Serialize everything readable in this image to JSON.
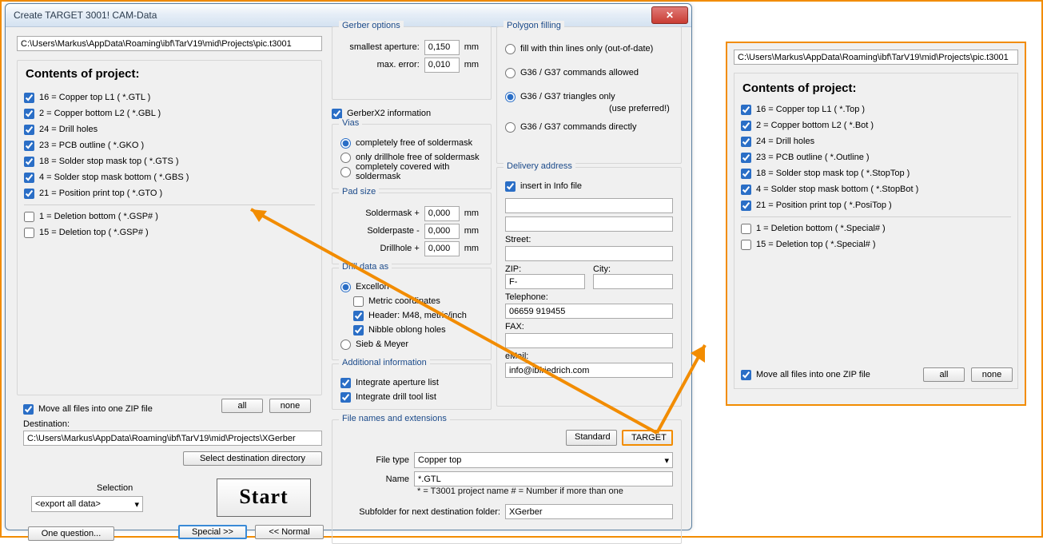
{
  "window": {
    "title": "Create TARGET 3001! CAM-Data"
  },
  "path": "C:\\Users\\Markus\\AppData\\Roaming\\ibf\\TarV19\\mid\\Projects\\pic.t3001",
  "contents_title": "Contents of project:",
  "layers_main": [
    {
      "c": true,
      "t": "16 = Copper top L1   ( *.GTL )"
    },
    {
      "c": true,
      "t": "2 = Copper bottom L2   ( *.GBL )"
    },
    {
      "c": true,
      "t": "24 = Drill holes"
    },
    {
      "c": true,
      "t": "23 = PCB outline   ( *.GKO )"
    },
    {
      "c": true,
      "t": "18 = Solder stop mask top   ( *.GTS )"
    },
    {
      "c": true,
      "t": "4 = Solder stop mask bottom   ( *.GBS )"
    },
    {
      "c": true,
      "t": "21 = Position print top   ( *.GTO )"
    }
  ],
  "layers_main_extra": [
    {
      "c": false,
      "t": "1 = Deletion bottom   ( *.GSP# )"
    },
    {
      "c": false,
      "t": "15 = Deletion top   ( *.GSP# )"
    }
  ],
  "zip_label": "Move all files into one ZIP file",
  "btn_all": "all",
  "btn_none": "none",
  "dest_label": "Destination:",
  "dest_path": "C:\\Users\\Markus\\AppData\\Roaming\\ibf\\TarV19\\mid\\Projects\\XGerber",
  "btn_seldest": "Select destination directory",
  "selection_label": "Selection",
  "selection_value": "<export all data>",
  "btn_start": "Start",
  "btn_oneq": "One question...",
  "btn_special": "Special >>",
  "btn_normal": "<<  Normal",
  "gerber": {
    "legend": "Gerber options",
    "ap_label": "smallest aperture:",
    "ap_value": "0,150",
    "err_label": "max. error:",
    "err_value": "0,010",
    "unit": "mm",
    "x2_label": "GerberX2 information"
  },
  "vias": {
    "legend": "Vias",
    "o1": "completely free of soldermask",
    "o2": "only drillhole free of soldermask",
    "o3": "completely covered with soldermask"
  },
  "pad": {
    "legend": "Pad size",
    "r1": "Soldermask  +",
    "r2": "Solderpaste  -",
    "r3": "Drillhole  +",
    "v": "0,000",
    "unit": "mm"
  },
  "drill": {
    "legend": "Drill data as",
    "excellon": "Excellon",
    "metric": "Metric coordinates",
    "header": "Header: M48, metric/inch",
    "nibble": "Nibble oblong holes",
    "sieb": "Sieb & Meyer"
  },
  "addl": {
    "legend": "Additional information",
    "a1": "Integrate aperture list",
    "a2": "Integrate drill tool list"
  },
  "poly": {
    "legend": "Polygon filling",
    "o1": "fill with thin lines only (out-of-date)",
    "o2": "G36 / G37 commands allowed",
    "o3": "G36 / G37 triangles only",
    "o3b": "(use preferred!)",
    "o4": "G36 / G37 commands directly"
  },
  "deliv": {
    "legend": "Delivery address",
    "insert": "insert in Info file",
    "street": "Street:",
    "zip": "ZIP:",
    "city": "City:",
    "zip_v": "F-",
    "tel": "Telephone:",
    "tel_v": "06659 919455",
    "fax": "FAX:",
    "email": "eMail:",
    "email_v": "info@ibfriedrich.com"
  },
  "fn": {
    "legend": "File names and extensions",
    "standard": "Standard",
    "target": "TARGET",
    "filetype_l": "File type",
    "filetype_v": "Copper top",
    "name_l": "Name",
    "name_v": "*.GTL",
    "hint": "* = T3001 project name            # = Number if more than one",
    "sub_l": "Subfolder for next destination folder:",
    "sub_v": "XGerber"
  },
  "panelR": {
    "path": "C:\\Users\\Markus\\AppData\\Roaming\\ibf\\TarV19\\mid\\Projects\\pic.t3001",
    "title": "Contents of project:",
    "layers": [
      {
        "c": true,
        "t": "16 = Copper top L1   ( *.Top )"
      },
      {
        "c": true,
        "t": "2 = Copper bottom L2   ( *.Bot )"
      },
      {
        "c": true,
        "t": "24 = Drill holes"
      },
      {
        "c": true,
        "t": "23 = PCB outline   ( *.Outline )"
      },
      {
        "c": true,
        "t": "18 = Solder stop mask top   ( *.StopTop )"
      },
      {
        "c": true,
        "t": "4 = Solder stop mask bottom   ( *.StopBot )"
      },
      {
        "c": true,
        "t": "21 = Position print top   ( *.PosiTop )"
      }
    ],
    "layers_extra": [
      {
        "c": false,
        "t": "1 = Deletion bottom   ( *.Special# )"
      },
      {
        "c": false,
        "t": "15 = Deletion top   ( *.Special# )"
      }
    ]
  }
}
